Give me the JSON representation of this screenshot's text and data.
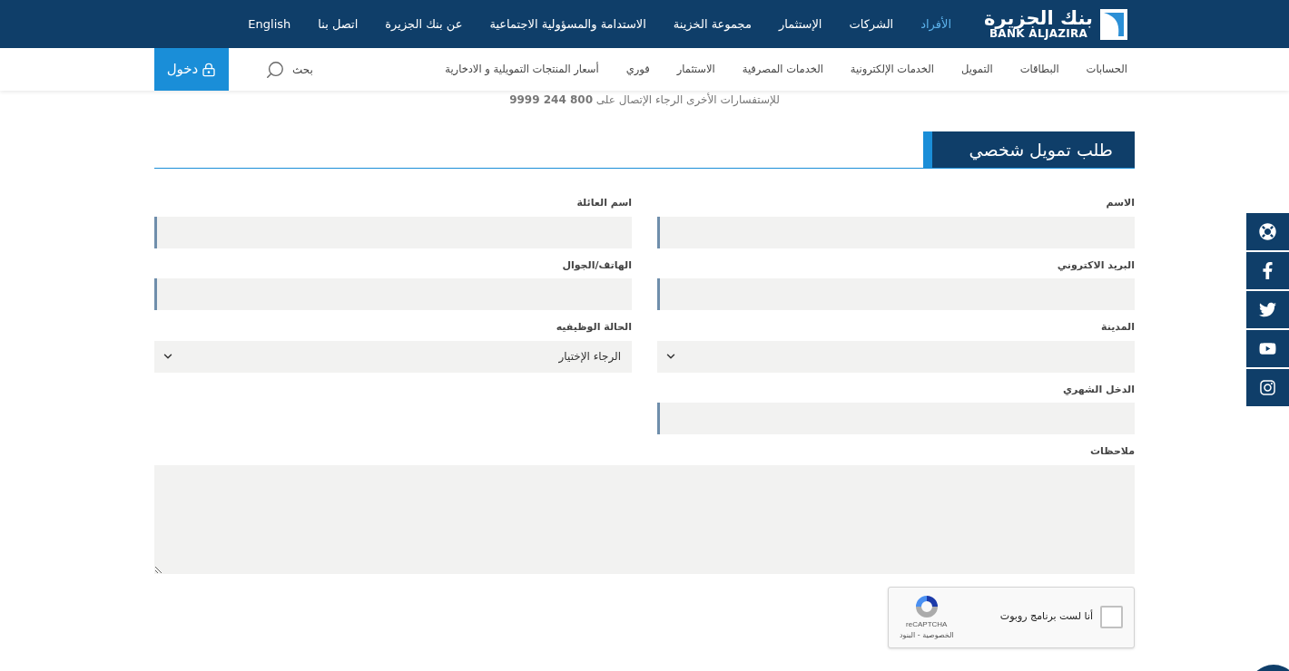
{
  "header": {
    "logo": {
      "arabic": "بنك الجزيرة",
      "latin": "BANK ALJAZIRA"
    },
    "top_nav": [
      {
        "label": "الأفراد",
        "selected": true
      },
      {
        "label": "الشركات",
        "selected": false
      },
      {
        "label": "الإستثمار",
        "selected": false
      },
      {
        "label": "مجموعة الخزينة",
        "selected": false
      },
      {
        "label": "الاستدامة والمسؤولية الاجتماعية",
        "selected": false
      },
      {
        "label": "عن بنك الجزيرة",
        "selected": false
      },
      {
        "label": "اتصل بنا",
        "selected": false
      },
      {
        "label": "English",
        "selected": false
      }
    ],
    "main_nav": [
      "الحسابات",
      "البطاقات",
      "التمويل",
      "الخدمات الإلكترونية",
      "الخدمات المصرفية",
      "الاستثمار",
      "فوري",
      "أسعار المنتجات التمويلية و الادخارية"
    ],
    "search": {
      "label": "بحث"
    },
    "login": {
      "label": "دخول"
    }
  },
  "notice": "للإستفسارات الأخرى الرجاء الإتصال على **800 244 9999**",
  "form": {
    "title": "طلب تمويل شخصي",
    "fields": [
      {
        "label": "الاسم",
        "kind": "text"
      },
      {
        "label": "اسم العائلة",
        "kind": "text"
      },
      {
        "label": "البريد الاكتروني",
        "kind": "text"
      },
      {
        "label": "الهاتف/الجوال",
        "kind": "text"
      },
      {
        "label": "المدينة",
        "kind": "select"
      },
      {
        "label": "الحالة الوظيفيه",
        "kind": "select",
        "value": "الرجاء الإختيار"
      },
      {
        "label": "الدخل الشهري",
        "kind": "text"
      }
    ],
    "notes": {
      "label": "ملاحظات"
    },
    "captcha": {
      "label": "أنا لست برنامج روبوت",
      "checked": false,
      "brand": "reCAPTCHA",
      "links": "الخصوصية - البنود"
    }
  }
}
